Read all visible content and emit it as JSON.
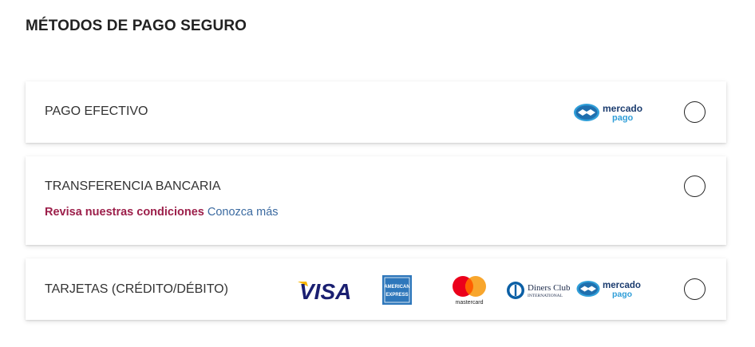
{
  "section_title": "MÉTODOS DE PAGO SEGURO",
  "methods": [
    {
      "label": "PAGO EFECTIVO",
      "logos": [
        "mercado-pago-logo"
      ]
    },
    {
      "label": "TRANSFERENCIA BANCARIA",
      "conditions_text": "Revisa nuestras condiciones",
      "more_link": "Conozca más"
    },
    {
      "label": "TARJETAS (CRÉDITO/DÉBITO)",
      "logos": [
        "visa-logo",
        "american-express-logo",
        "mastercard-logo",
        "diners-club-logo",
        "mercado-pago-logo"
      ]
    }
  ],
  "logo_text": {
    "mercado_pago_1": "mercado",
    "mercado_pago_2": "pago",
    "visa": "VISA",
    "amex_1": "AMERICAN",
    "amex_2": "EXPRESS",
    "mastercard": "mastercard",
    "diners_1": "Diners Club",
    "diners_2": "INTERNATIONAL"
  },
  "colors": {
    "accent_conditions": "#9c1f4a",
    "link": "#3b6aa0",
    "visa_blue": "#1a1f71",
    "visa_gold": "#f7b600",
    "amex_blue": "#2e77bb",
    "mc_red": "#eb001b",
    "mc_orange": "#f79e1b",
    "mp_blue": "#2f9ed8"
  }
}
